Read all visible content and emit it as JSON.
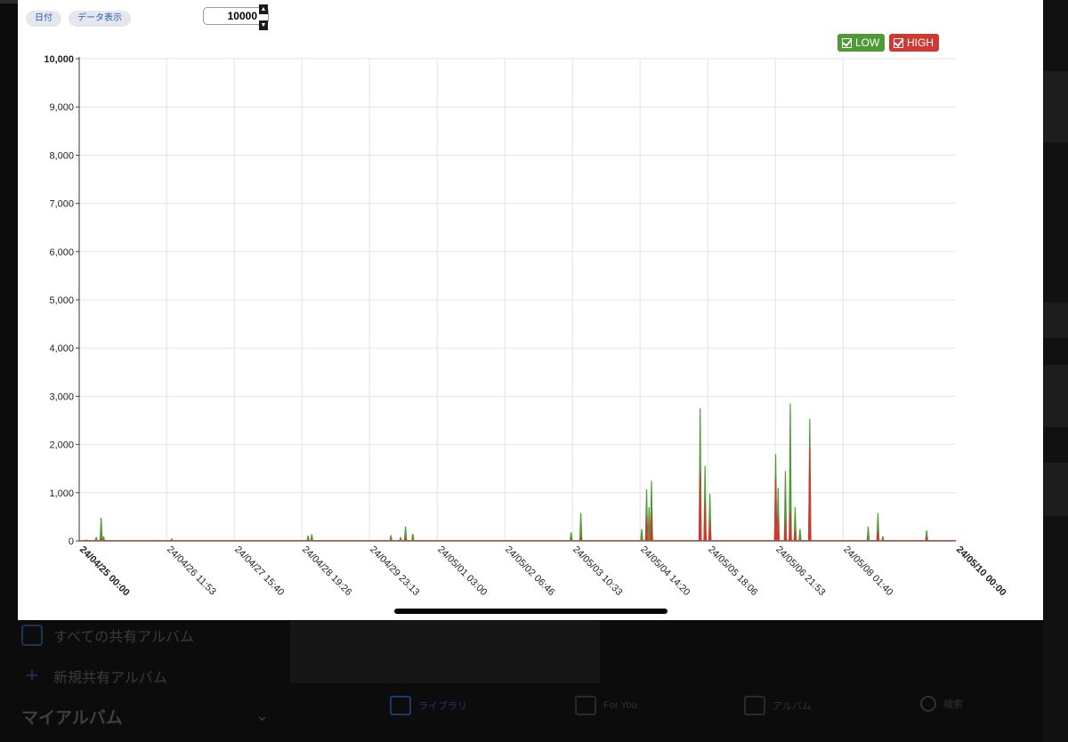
{
  "toolbar": {
    "date_button": "日付",
    "data_view_button": "データ表示",
    "max_value": "10000"
  },
  "legend": {
    "low_label": "LOW",
    "high_label": "HIGH",
    "low_color": "#4f9a36",
    "high_color": "#cc3b33"
  },
  "background_app": {
    "sidebar_all_shared": "すべての共有アルバム",
    "sidebar_new_shared": "新規共有アルバム",
    "my_albums": "マイアルバム",
    "tabs": [
      "ライブラリ",
      "For You",
      "アルバム",
      "検索"
    ]
  },
  "chart_data": {
    "type": "area",
    "ylim": [
      0,
      10000
    ],
    "yticks": [
      0,
      1000,
      2000,
      3000,
      4000,
      5000,
      6000,
      7000,
      8000,
      9000,
      10000
    ],
    "ytick_labels": [
      "0",
      "1,000",
      "2,000",
      "3,000",
      "4,000",
      "5,000",
      "6,000",
      "7,000",
      "8,000",
      "9,000",
      "10,000"
    ],
    "x_start": "24/04/25 00:00",
    "x_end": "24/05/10 00:00",
    "xtick_labels": [
      "24/04/25 00:00",
      "24/04/26 11:53",
      "24/04/27 15:40",
      "24/04/28 19:26",
      "24/04/29 23:13",
      "24/05/01 03:00",
      "24/05/02 06:46",
      "24/05/03 10:33",
      "24/05/04 14:20",
      "24/05/05 18:06",
      "24/05/06 21:53",
      "24/05/08 01:40",
      "24/05/10 00:00"
    ],
    "grid": true,
    "legend_position": "top-right",
    "series": [
      {
        "name": "LOW",
        "color": "#4f9a36",
        "points": [
          [
            "24/04/25 03:00",
            30
          ],
          [
            "24/04/25 07:00",
            80
          ],
          [
            "24/04/25 09:00",
            480
          ],
          [
            "24/04/25 10:00",
            100
          ],
          [
            "24/04/26 14:00",
            50
          ],
          [
            "24/04/28 22:00",
            110
          ],
          [
            "24/04/28 23:30",
            140
          ],
          [
            "24/04/30 08:00",
            120
          ],
          [
            "24/04/30 12:00",
            80
          ],
          [
            "24/04/30 14:00",
            300
          ],
          [
            "24/04/30 17:00",
            150
          ],
          [
            "24/05/03 10:00",
            180
          ],
          [
            "24/05/03 14:00",
            580
          ],
          [
            "24/05/04 15:00",
            250
          ],
          [
            "24/05/04 17:00",
            1070
          ],
          [
            "24/05/04 18:00",
            700
          ],
          [
            "24/05/04 19:00",
            1250
          ],
          [
            "24/05/05 15:00",
            2750
          ],
          [
            "24/05/05 17:00",
            1550
          ],
          [
            "24/05/05 19:00",
            980
          ],
          [
            "24/05/06 22:00",
            1800
          ],
          [
            "24/05/06 23:00",
            1100
          ],
          [
            "24/05/07 02:00",
            1450
          ],
          [
            "24/05/07 04:00",
            2850
          ],
          [
            "24/05/07 06:00",
            700
          ],
          [
            "24/05/07 08:00",
            250
          ],
          [
            "24/05/07 12:00",
            2530
          ],
          [
            "24/05/08 12:00",
            300
          ],
          [
            "24/05/08 16:00",
            580
          ],
          [
            "24/05/08 18:00",
            100
          ],
          [
            "24/05/09 12:00",
            220
          ]
        ]
      },
      {
        "name": "HIGH",
        "color": "#cc3b33",
        "points": [
          [
            "24/04/25 09:00",
            60
          ],
          [
            "24/04/30 14:00",
            80
          ],
          [
            "24/05/03 14:00",
            80
          ],
          [
            "24/05/04 17:00",
            500
          ],
          [
            "24/05/04 19:00",
            600
          ],
          [
            "24/05/05 15:00",
            1400
          ],
          [
            "24/05/05 17:00",
            800
          ],
          [
            "24/05/05 19:00",
            400
          ],
          [
            "24/05/06 22:00",
            1300
          ],
          [
            "24/05/06 23:00",
            500
          ],
          [
            "24/05/07 02:00",
            400
          ],
          [
            "24/05/07 04:00",
            600
          ],
          [
            "24/05/07 06:00",
            200
          ],
          [
            "24/05/07 12:00",
            1950
          ],
          [
            "24/05/08 16:00",
            200
          ],
          [
            "24/05/09 12:00",
            80
          ]
        ]
      }
    ]
  }
}
